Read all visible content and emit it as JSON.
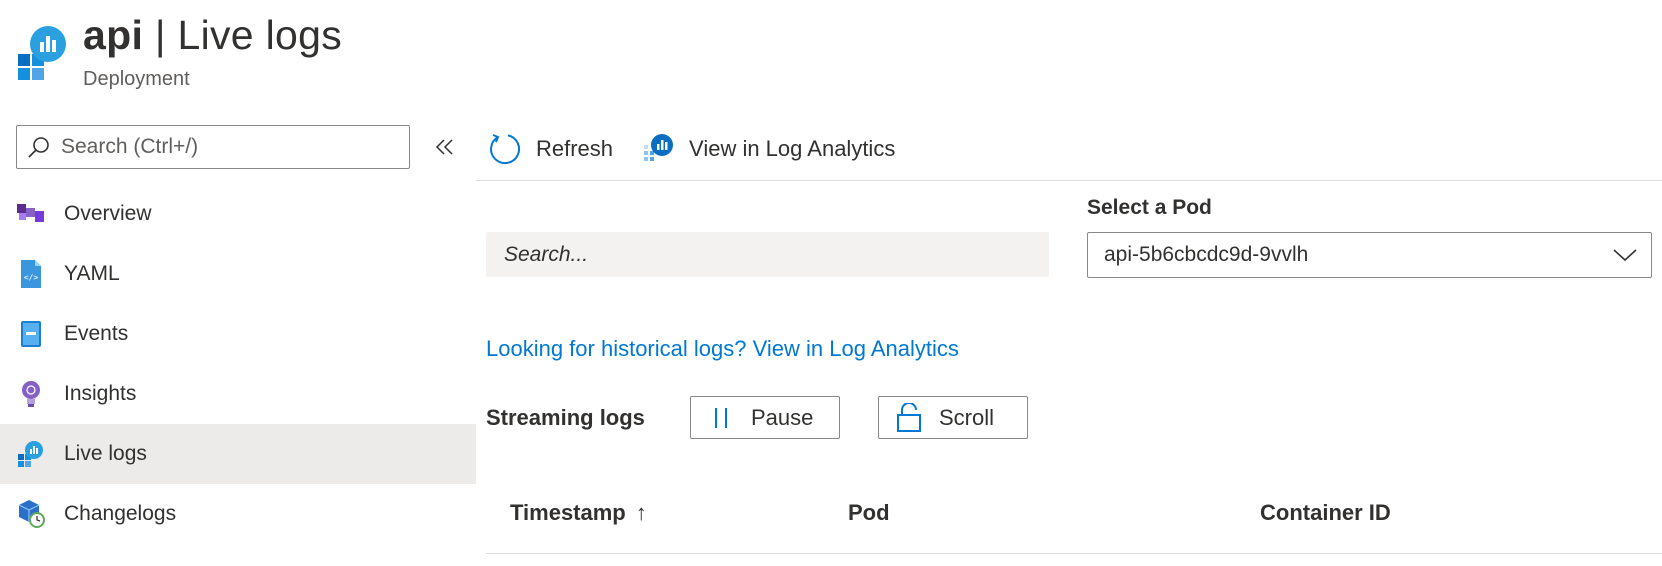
{
  "header": {
    "resource_name": "api",
    "separator": " | ",
    "page_name": "Live logs",
    "subtitle": "Deployment"
  },
  "sidebar": {
    "search_placeholder": "Search (Ctrl+/)",
    "items": [
      {
        "label": "Overview",
        "icon": "overview-icon",
        "active": false
      },
      {
        "label": "YAML",
        "icon": "yaml-icon",
        "active": false
      },
      {
        "label": "Events",
        "icon": "events-icon",
        "active": false
      },
      {
        "label": "Insights",
        "icon": "insights-icon",
        "active": false
      },
      {
        "label": "Live logs",
        "icon": "live-logs-icon",
        "active": true
      },
      {
        "label": "Changelogs",
        "icon": "changelogs-icon",
        "active": false
      }
    ]
  },
  "toolbar": {
    "refresh_label": "Refresh",
    "log_analytics_label": "View in Log Analytics"
  },
  "filters": {
    "search_placeholder": "Search...",
    "pod_label": "Select a Pod",
    "pod_value": "api-5b6cbcdc9d-9vvlh"
  },
  "historical_link": "Looking for historical logs? View in Log Analytics",
  "streaming": {
    "label": "Streaming logs",
    "pause_label": "Pause",
    "scroll_label": "Scroll"
  },
  "table": {
    "columns": [
      "Timestamp",
      "Pod",
      "Container ID"
    ],
    "sort_indicator": "↑"
  },
  "colors": {
    "accent": "#0078d4",
    "active_nav_bg": "#edebe9",
    "text": "#323130"
  }
}
